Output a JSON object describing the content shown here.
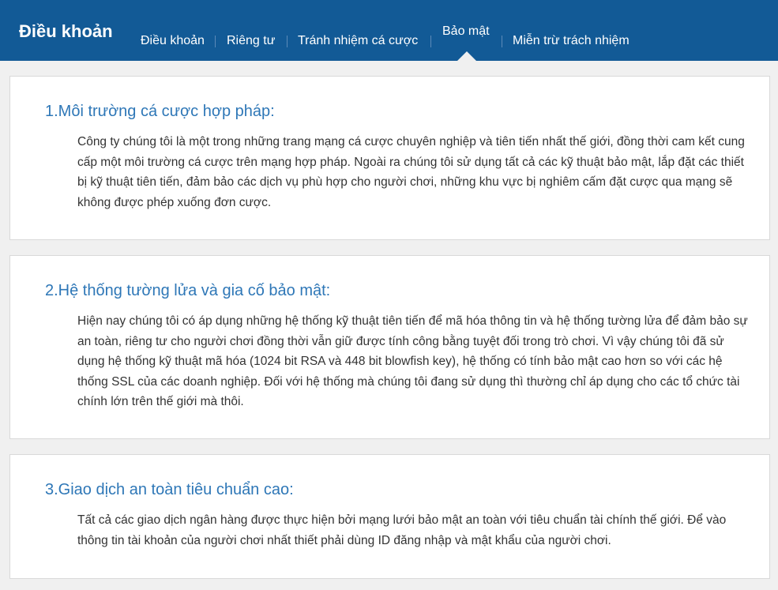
{
  "header": {
    "brand": "Điều khoản",
    "nav": [
      {
        "label": "Điều khoản"
      },
      {
        "label": "Riêng tư"
      },
      {
        "label": "Tránh nhiệm cá cược"
      },
      {
        "label": "Bảo mật",
        "active": true
      },
      {
        "label": "Miễn trừ trách nhiệm"
      }
    ]
  },
  "sections": [
    {
      "title": "1.Môi trường cá cược hợp pháp:",
      "body": "Công ty chúng tôi là một trong những trang mạng cá cược chuyên nghiệp và tiên tiến nhất thế giới, đồng thời cam kết cung cấp một môi trường cá cược trên mạng hợp pháp. Ngoài ra chúng tôi sử dụng tất cả các kỹ thuật bảo mật, lắp đặt các thiết bị kỹ thuật tiên tiến, đảm bảo các dịch vụ phù hợp cho người chơi, những khu vực bị nghiêm cấm đặt cược qua mạng sẽ không được phép xuống đơn cược."
    },
    {
      "title": "2.Hệ thống tường lửa và gia cố bảo mật:",
      "body": "Hiện nay chúng tôi có áp dụng những hệ thống kỹ thuật tiên tiến để mã hóa thông tin và hệ thống tường lửa để đảm bảo sự an toàn, riêng tư cho người chơi đồng thời vẫn giữ được tính công bằng tuyệt đối trong trò chơi. Vì vậy chúng tôi đã sử dụng hệ thống kỹ thuật mã hóa (1024 bit RSA và 448 bit blowfish key), hệ thống có tính bảo mật cao hơn so với các hệ thống SSL của các doanh nghiệp. Đối với hệ thống mà chúng tôi đang sử dụng thì thường chỉ áp dụng cho các tổ chức tài chính lớn trên thế giới mà thôi."
    },
    {
      "title": "3.Giao dịch an toàn tiêu chuẩn cao:",
      "body": "Tất cả các giao dịch ngân hàng được thực hiện bởi mạng lưới bảo mật an toàn với tiêu chuẩn tài chính thế giới. Để vào thông tin tài khoản của người chơi nhất thiết phải dùng ID đăng nhập và mật khẩu của người chơi."
    }
  ]
}
